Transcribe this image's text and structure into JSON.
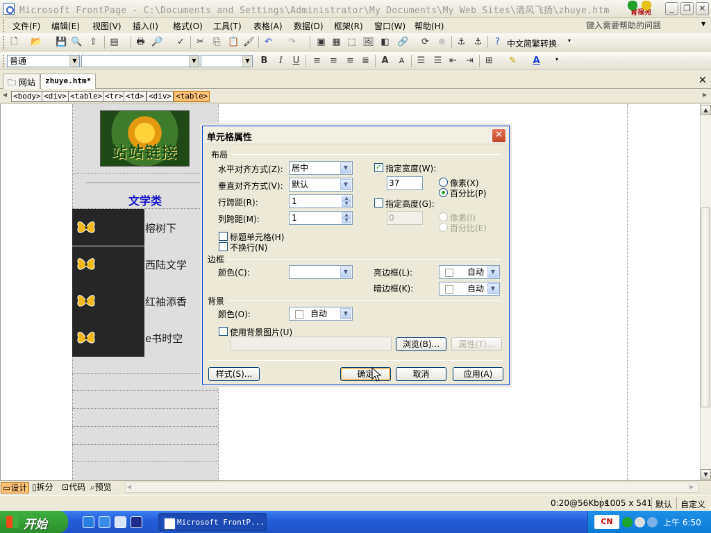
{
  "window": {
    "title": "Microsoft FrontPage - C:\\Documents and Settings\\Administrator\\My Documents\\My Web Sites\\清风飞扬\\zhuye.htm",
    "logo_text": "育禄苑",
    "buttons": {
      "minimize": "_",
      "restore": "❐",
      "close": "✕"
    }
  },
  "menu": {
    "items": [
      "文件(F)",
      "编辑(E)",
      "视图(V)",
      "插入(I)",
      "格式(O)",
      "工具(T)",
      "表格(A)",
      "数据(D)",
      "框架(R)",
      "窗口(W)",
      "帮助(H)"
    ],
    "help_placeholder": "键入需要帮助的问题"
  },
  "toolbar": {
    "convert_label": "中文简繁转换",
    "style_value": "普通",
    "font_value": "",
    "size_value": ""
  },
  "tabs": [
    {
      "label": "网站"
    },
    {
      "label": "zhuye.htm*"
    }
  ],
  "tagbar": {
    "tags": [
      "<body>",
      "<div>",
      "<table>",
      "<tr>",
      "<td>",
      "<div>",
      "<table>"
    ]
  },
  "page": {
    "banner_text": "站站链接",
    "category_title": "文学类",
    "links": [
      "榕树下",
      "西陆文学",
      "红袖添香",
      "e书时空"
    ]
  },
  "dialog": {
    "title": "单元格属性",
    "layout_group": "布局",
    "halign_label": "水平对齐方式(Z):",
    "halign_value": "居中",
    "valign_label": "垂直对齐方式(V):",
    "valign_value": "默认",
    "rowspan_label": "行跨距(R):",
    "rowspan_value": "1",
    "colspan_label": "列跨距(M):",
    "colspan_value": "1",
    "header_cell_label": "标题单元格(H)",
    "nowrap_label": "不换行(N)",
    "width_label": "指定宽度(W):",
    "width_checked": true,
    "width_value": "37",
    "pixels_label": "像素(X)",
    "percent_label": "百分比(P)",
    "height_label": "指定高度(G):",
    "height_checked": false,
    "height_value": "0",
    "height_pixels_label": "像素(I)",
    "height_percent_label": "百分比(E)",
    "border_group": "边框",
    "border_color_label": "颜色(C):",
    "border_color_value": "",
    "light_border_label": "亮边框(L):",
    "light_border_value": "自动",
    "dark_border_label": "暗边框(K):",
    "dark_border_value": "自动",
    "bg_group": "背景",
    "bg_color_label": "颜色(O):",
    "bg_color_value": "自动",
    "bg_image_label": "使用背景图片(U)",
    "browse_label": "浏览(B)...",
    "props_label": "属性(T)...",
    "style_button": "样式(S)...",
    "ok_button": "确定",
    "cancel_button": "取消",
    "apply_button": "应用(A)"
  },
  "viewbar": {
    "tabs": [
      "设计",
      "拆分",
      "代码",
      "预览"
    ]
  },
  "status": {
    "speed": "0:20@56Kbps",
    "size": "1005 x 541",
    "mode": "默认",
    "custom": "自定义"
  },
  "taskbar": {
    "start_label": "开始",
    "task_label": "Microsoft FrontP...",
    "clock": "上午 6:50",
    "ime_label": "CN"
  },
  "colors": {
    "accent_blue": "#1414c8",
    "selected_tag": "#ffc47a",
    "taskbar_blue": "#245edb",
    "start_green": "#3fae3f"
  }
}
